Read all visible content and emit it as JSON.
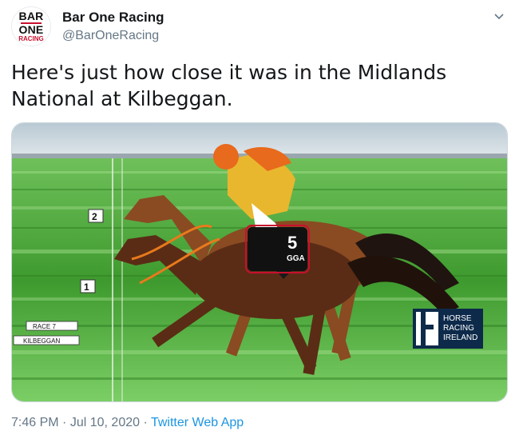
{
  "account": {
    "display_name": "Bar One Racing",
    "handle": "@BarOneRacing",
    "avatar_text": {
      "line1": "BAR",
      "line2": "ONE",
      "line3": "RACING"
    }
  },
  "tweet": {
    "text": "Here's just how close it was in the Midlands National at Kilbeggan."
  },
  "photo": {
    "markers": {
      "second": "2",
      "first": "1"
    },
    "race_label": "RACE 7",
    "course_label": "KILBEGGAN",
    "saddle_cloth_number": "5",
    "saddle_cloth_text": "GGA",
    "logo_text": {
      "line1": "HORSE",
      "line2": "RACING",
      "line3": "IRELAND"
    }
  },
  "meta": {
    "time": "7:46 PM",
    "separator": "·",
    "date": "Jul 10, 2020",
    "source": "Twitter Web App"
  },
  "colors": {
    "accent": "#1b95e0",
    "brand_red": "#c8102e",
    "turf_green": "#3e9a2e"
  }
}
